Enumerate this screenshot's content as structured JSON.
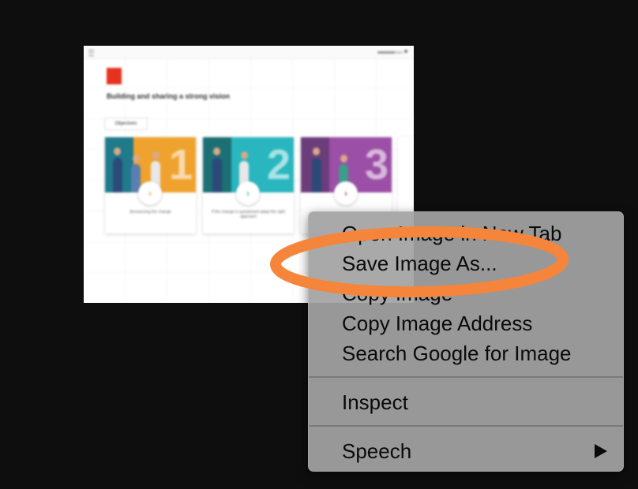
{
  "background_color": "#0e0e0e",
  "screenshot": {
    "title": "Building and sharing a strong vision",
    "objectives_label": "Objectives",
    "progress_fraction": 0.7,
    "cards": [
      {
        "number": "1",
        "caption": "Announcing the change",
        "accent": "#f0a22e",
        "photo": "#1f7a8c"
      },
      {
        "number": "2",
        "caption": "If the change is questioned adapt the right approach",
        "accent": "#29b6bf",
        "photo": "#1c6f74"
      },
      {
        "number": "3",
        "caption": "",
        "accent": "#9c4fa6",
        "photo": "#6b3d7a"
      }
    ]
  },
  "context_menu": {
    "items": [
      {
        "label": "Open Image in New Tab"
      },
      {
        "label": "Save Image As..."
      },
      {
        "label": "Copy Image"
      },
      {
        "label": "Copy Image Address"
      },
      {
        "label": "Search Google for Image"
      },
      {
        "label": "Inspect"
      },
      {
        "label": "Speech"
      }
    ]
  },
  "highlight_color": "#f5853a"
}
